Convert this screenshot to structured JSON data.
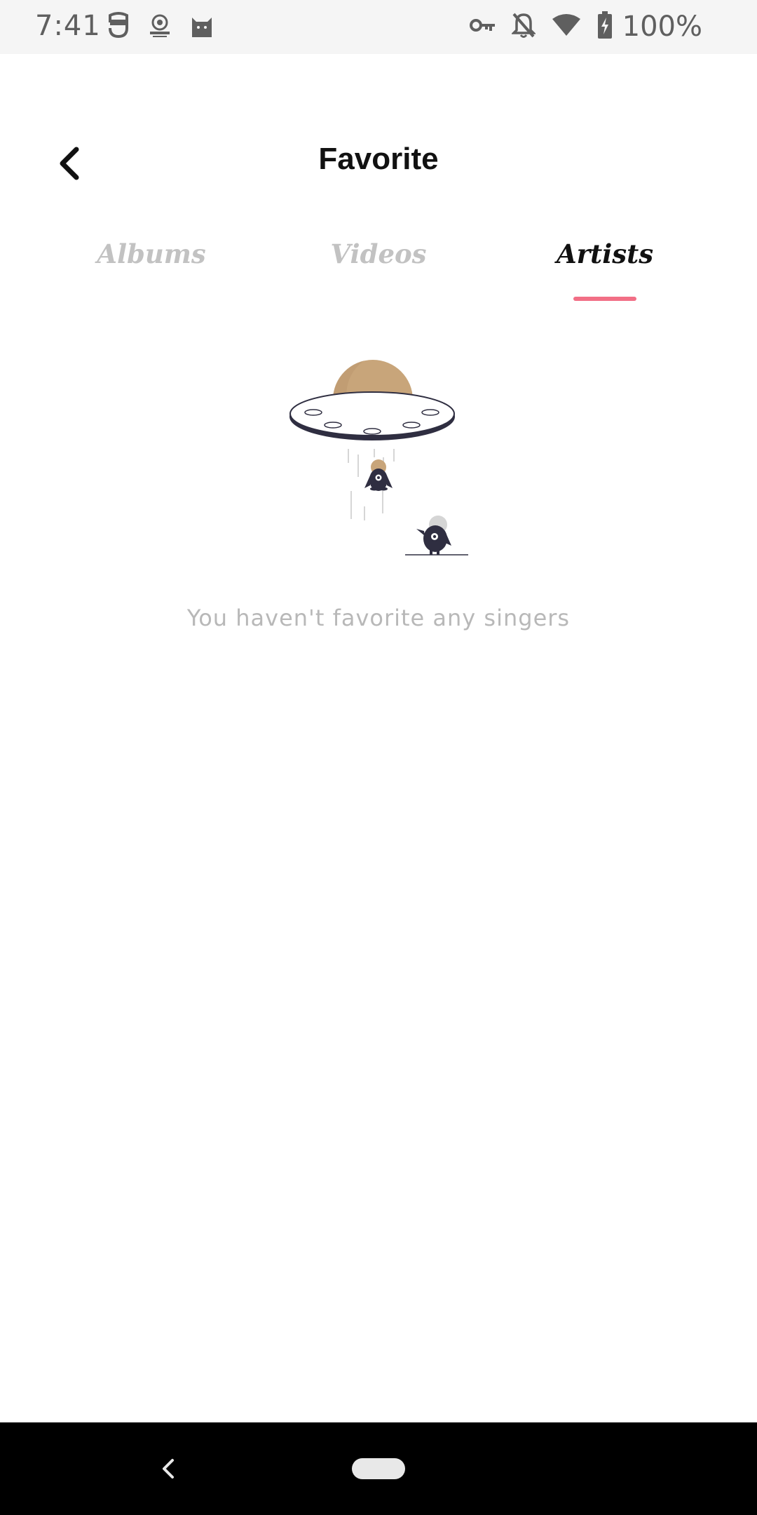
{
  "status_bar": {
    "time": "7:41",
    "battery_text": "100%",
    "left_icons": [
      "mask-icon",
      "badge-logo-icon",
      "cat-icon"
    ],
    "right_icons": [
      "vpn-key-icon",
      "bell-off-icon",
      "wifi-icon",
      "battery-charging-icon"
    ]
  },
  "header": {
    "title": "Favorite",
    "back_icon": "chevron-left-icon"
  },
  "tabs": [
    {
      "label": "Albums",
      "active": false
    },
    {
      "label": "Videos",
      "active": false
    },
    {
      "label": "Artists",
      "active": true
    }
  ],
  "colors": {
    "accent": "#f26f86",
    "inactive_tab": "#c2c2c2",
    "empty_text": "#b8b8b8",
    "ufo_dome": "#c8a57a",
    "alien_body": "#2f2e41"
  },
  "empty_state": {
    "illustration": "ufo-abduction-illustration",
    "message": "You haven't favorite any singers"
  },
  "nav_bar": {
    "back_icon": "nav-back-icon",
    "home_icon": "nav-home-pill"
  }
}
